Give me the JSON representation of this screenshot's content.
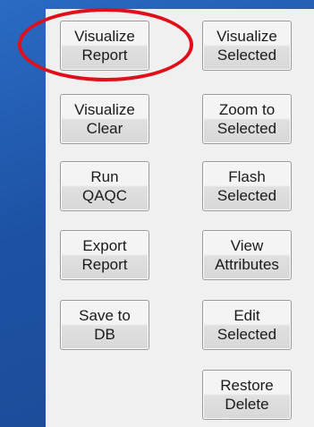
{
  "buttons": {
    "visualize_report": "Visualize\nReport",
    "visualize_selected": "Visualize\nSelected",
    "visualize_clear": "Visualize\nClear",
    "zoom_to_selected": "Zoom to\nSelected",
    "run_qaqc": "Run\nQAQC",
    "flash_selected": "Flash\nSelected",
    "export_report": "Export\nReport",
    "view_attributes": "View\nAttributes",
    "save_to_db": "Save to\nDB",
    "edit_selected": "Edit\nSelected",
    "restore_delete": "Restore\nDelete"
  },
  "annotation": {
    "highlight_color": "#e0101a"
  },
  "colors": {
    "desktop_background": "#1f56a8",
    "panel_background": "#f0f0f0"
  }
}
